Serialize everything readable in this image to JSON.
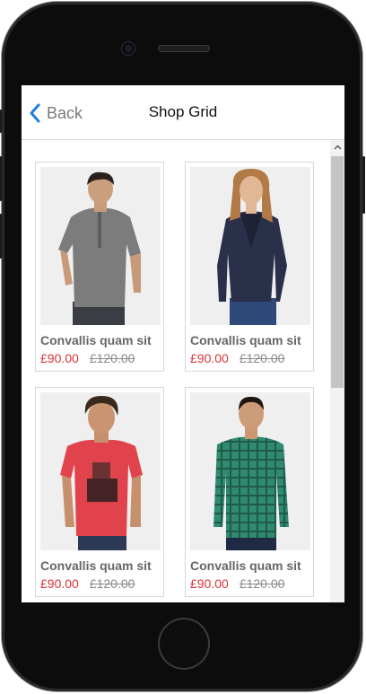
{
  "nav": {
    "back_label": "Back",
    "title": "Shop Grid"
  },
  "products": [
    {
      "name": "Convallis quam sit",
      "price": "£90.00",
      "old_price": "£120.00",
      "image": "man-grey-polo"
    },
    {
      "name": "Convallis quam sit",
      "price": "£90.00",
      "old_price": "£120.00",
      "image": "woman-navy-jacket"
    },
    {
      "name": "Convallis quam sit",
      "price": "£90.00",
      "old_price": "£120.00",
      "image": "man-red-graphic-tee"
    },
    {
      "name": "Convallis quam sit",
      "price": "£90.00",
      "old_price": "£120.00",
      "image": "man-green-plaid-shirt"
    }
  ],
  "colors": {
    "accent": "#1f7fe0",
    "price": "#d9343a",
    "old_price": "#8a8a8a"
  }
}
